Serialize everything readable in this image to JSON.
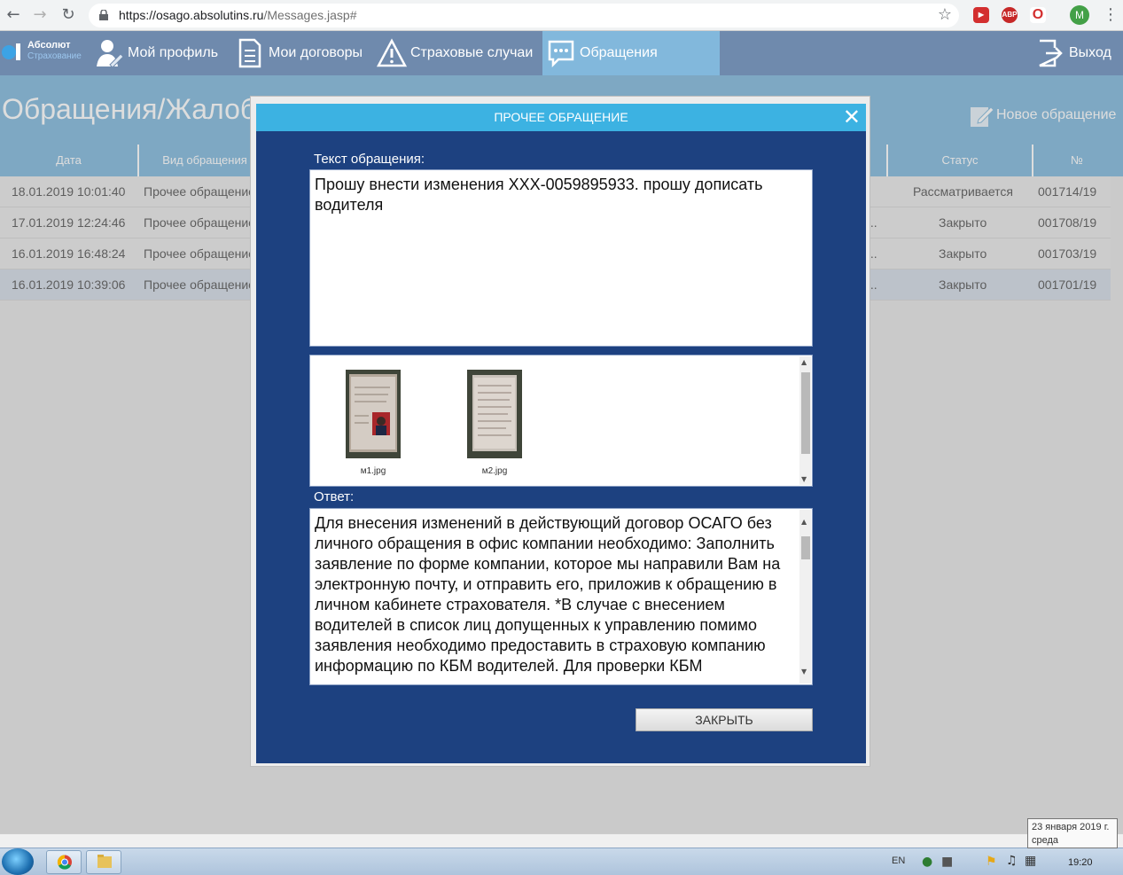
{
  "browser": {
    "url_host": "https://osago.absolutins.ru",
    "url_path": "/Messages.jasp#",
    "ext_abp": "ABP"
  },
  "brand": {
    "name": "Абсолют",
    "sub": "Страхование"
  },
  "nav": {
    "items": [
      {
        "label": "Мой профиль"
      },
      {
        "label": "Мои договоры"
      },
      {
        "label": "Страховые случаи"
      },
      {
        "label": "Обращения"
      }
    ],
    "logout": "Выход",
    "user_initial": "M"
  },
  "page": {
    "title": "Обращения/Жалобы",
    "new_request": "Новое обращение"
  },
  "table": {
    "columns": [
      "Дата",
      "Вид обращения",
      "Статус",
      "№"
    ],
    "rows": [
      {
        "date": "18.01.2019 10:01:40",
        "type": "Прочее обращение",
        "subject": "",
        "status": "Рассматривается",
        "num": "001714/19"
      },
      {
        "date": "17.01.2019 12:24:46",
        "type": "Прочее обращение",
        "subject": "...",
        "status": "Закрыто",
        "num": "001708/19"
      },
      {
        "date": "16.01.2019 16:48:24",
        "type": "Прочее обращение",
        "subject": "...",
        "status": "Закрыто",
        "num": "001703/19"
      },
      {
        "date": "16.01.2019 10:39:06",
        "type": "Прочее обращение",
        "subject": "...",
        "status": "Закрыто",
        "num": "001701/19"
      }
    ]
  },
  "modal": {
    "title": "ПРОЧЕЕ ОБРАЩЕНИЕ",
    "text_label": "Текст обращения:",
    "text": "Прошу внести изменения ХХХ-0059895933. прошу дописать водителя",
    "attachments": [
      {
        "name": "м1.jpg"
      },
      {
        "name": "м2.jpg"
      }
    ],
    "answer_label": "Ответ:",
    "answer": "Для внесения изменений в действующий договор ОСАГО без личного обращения в офис компании необходимо: Заполнить заявление по форме компании, которое мы направили Вам на электронную почту, и отправить его, приложив к обращению в личном кабинете страхователя. *В случае с внесением водителей в список лиц допущенных к управлению помимо заявления необходимо предоставить в страховую компанию информацию по КБМ водителей. Для проверки КБМ",
    "close_button": "ЗАКРЫТЬ"
  },
  "taskbar": {
    "lang": "EN",
    "time": "19:20",
    "tooltip_date": "23 января 2019 г.",
    "tooltip_day": "среда"
  }
}
